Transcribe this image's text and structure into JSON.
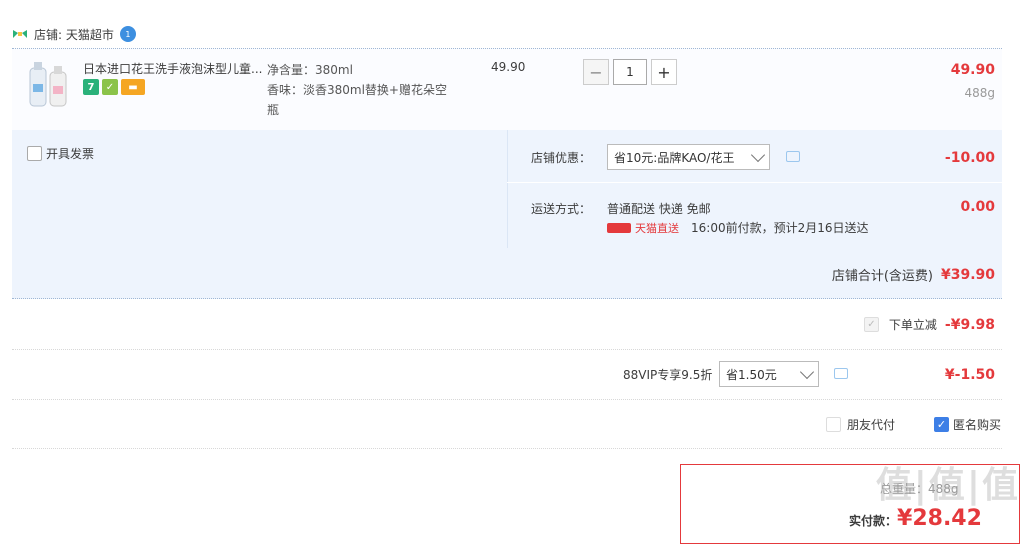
{
  "shop": {
    "label": "店铺: 天猫超市",
    "badge": "1"
  },
  "item": {
    "title": "日本进口花王洗手液泡沫型儿童...",
    "spec_volume": "净含量：380ml",
    "spec_scent": "香味：淡香380ml替换+赠花朵空",
    "spec_scent_cont": "瓶",
    "unit_price": "49.90",
    "quantity": "1",
    "minus": "−",
    "plus": "+",
    "sum_price": "49.90",
    "weight": "488g",
    "tags": [
      "7",
      "✓",
      "▬"
    ]
  },
  "invoice": {
    "label": "开具发票"
  },
  "shop_discount": {
    "label": "店铺优惠：",
    "selected": "省10元:品牌KAO/花王",
    "value": "-10.00"
  },
  "shipping": {
    "label": "运送方式：",
    "method": "普通配送 快递 免邮",
    "tmall_label": "天猫直送",
    "eta": "16:00前付款，预计2月16日送达",
    "value": "0.00"
  },
  "shop_total": {
    "label": "店铺合计(含运费)",
    "value": "¥39.90"
  },
  "order_discount": {
    "label": "下单立减",
    "value": "-¥9.98"
  },
  "vip": {
    "label": "88VIP专享9.5折",
    "selected": "省1.50元",
    "value": "¥-1.50"
  },
  "options": {
    "friend_pay": "朋友代付",
    "anonymous": "匿名购买"
  },
  "payment": {
    "weight_label": "总重量：488g",
    "actual_label": "实付款：",
    "amount": "¥28.42"
  },
  "watermark": "值|值|值",
  "colors": {
    "accent_red": "#e4393c",
    "panel_blue": "#eef4fd",
    "check_blue": "#3d7fe6"
  }
}
